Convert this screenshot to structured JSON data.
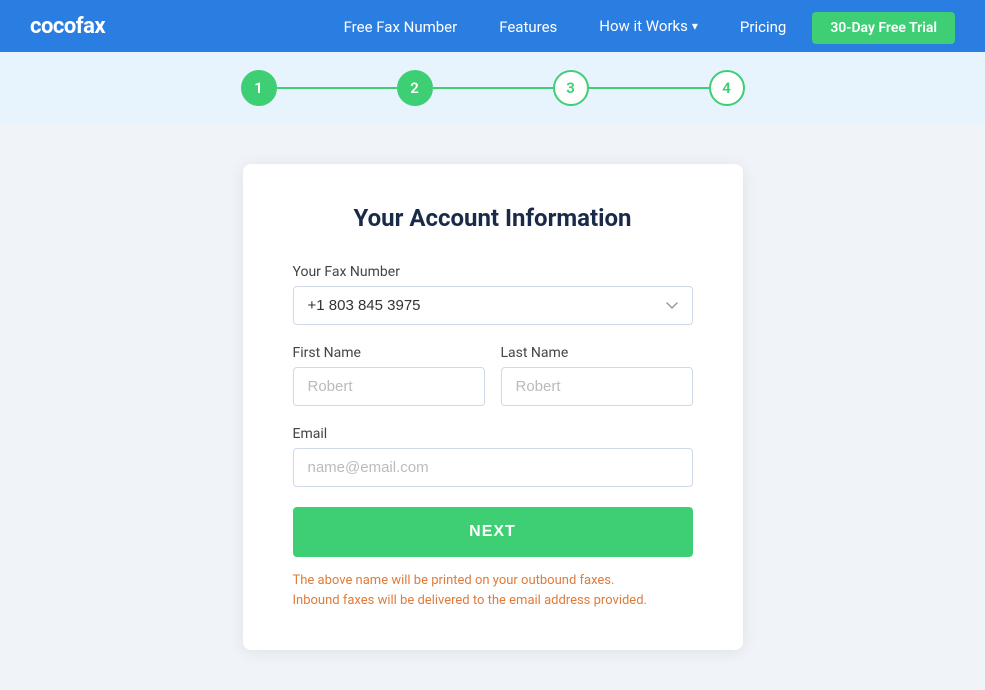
{
  "brand": {
    "logo": "cocofax"
  },
  "navbar": {
    "links": [
      {
        "id": "free-fax-number",
        "label": "Free Fax Number",
        "hasDropdown": false
      },
      {
        "id": "features",
        "label": "Features",
        "hasDropdown": false
      },
      {
        "id": "how-it-works",
        "label": "How it Works",
        "hasDropdown": true
      },
      {
        "id": "pricing",
        "label": "Pricing",
        "hasDropdown": false
      }
    ],
    "cta_label": "30-Day Free Trial"
  },
  "stepper": {
    "steps": [
      "1",
      "2",
      "3",
      "4"
    ],
    "active_up_to": 2
  },
  "form": {
    "title": "Your Account Information",
    "fax_number_label": "Your Fax Number",
    "fax_number_value": "+1 803 845 3975",
    "first_name_label": "First Name",
    "first_name_placeholder": "Robert",
    "last_name_label": "Last Name",
    "last_name_placeholder": "Robert",
    "email_label": "Email",
    "email_placeholder": "name@email.com",
    "next_button": "NEXT",
    "note_line1": "The above name will be printed on your outbound faxes.",
    "note_line2": "Inbound faxes will be delivered to the email address provided."
  }
}
